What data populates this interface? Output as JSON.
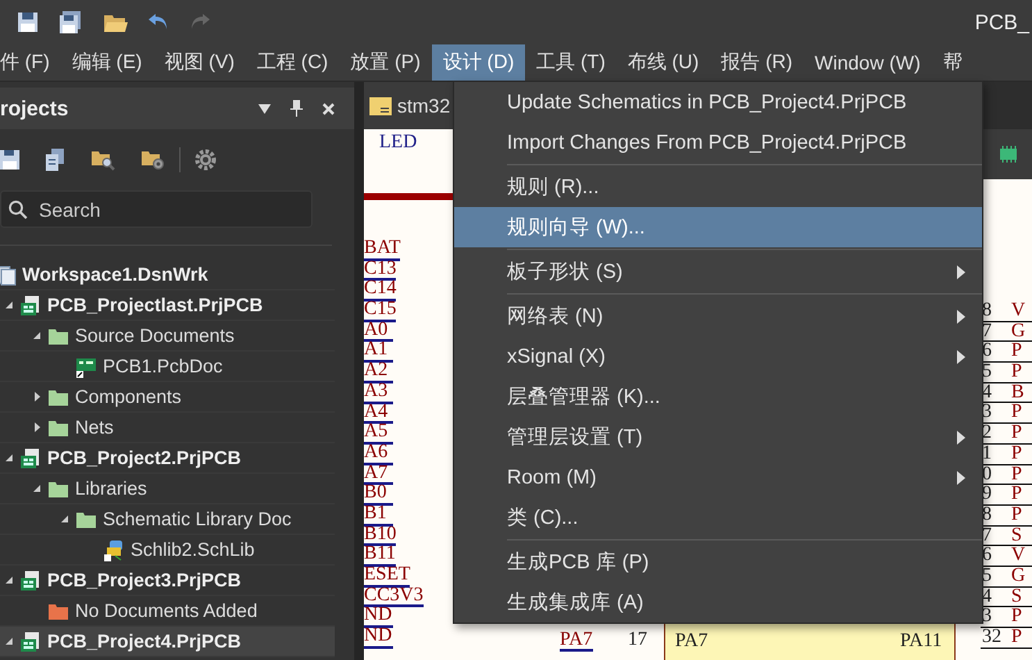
{
  "title_bar": {
    "title": "PCB_"
  },
  "menu_bar": [
    {
      "label": "件 (F)",
      "selected": false
    },
    {
      "label": "编辑 (E)",
      "selected": false
    },
    {
      "label": "视图 (V)",
      "selected": false
    },
    {
      "label": "工程 (C)",
      "selected": false
    },
    {
      "label": "放置 (P)",
      "selected": false
    },
    {
      "label": "设计 (D)",
      "selected": true
    },
    {
      "label": "工具 (T)",
      "selected": false
    },
    {
      "label": "布线 (U)",
      "selected": false
    },
    {
      "label": "报告 (R)",
      "selected": false
    },
    {
      "label": "Window (W)",
      "selected": false
    },
    {
      "label": "帮",
      "selected": false
    }
  ],
  "panel": {
    "title": "rojects",
    "search": {
      "placeholder": "Search"
    },
    "tree": [
      {
        "label": "Workspace1.DsnWrk",
        "kind": "workspace",
        "selected": false,
        "children": [
          {
            "label": "PCB_Projectlast.PrjPCB",
            "kind": "project",
            "expanded": true,
            "selected": false,
            "children": [
              {
                "label": "Source Documents",
                "kind": "folder",
                "expanded": true,
                "selected": false,
                "children": [
                  {
                    "label": "PCB1.PcbDoc",
                    "kind": "pcbdoc",
                    "selected": false
                  }
                ]
              },
              {
                "label": "Components",
                "kind": "folder",
                "expanded": false,
                "selected": false
              },
              {
                "label": "Nets",
                "kind": "folder",
                "expanded": false,
                "selected": false
              }
            ]
          },
          {
            "label": "PCB_Project2.PrjPCB",
            "kind": "project",
            "expanded": true,
            "selected": false,
            "children": [
              {
                "label": "Libraries",
                "kind": "folder",
                "expanded": true,
                "selected": false,
                "children": [
                  {
                    "label": "Schematic Library Doc",
                    "kind": "folder",
                    "expanded": true,
                    "selected": false,
                    "children": [
                      {
                        "label": "Schlib2.SchLib",
                        "kind": "schlib",
                        "selected": false
                      }
                    ]
                  }
                ]
              }
            ]
          },
          {
            "label": "PCB_Project3.PrjPCB",
            "kind": "project",
            "expanded": true,
            "selected": false,
            "children": [
              {
                "label": "No Documents Added",
                "kind": "empty-folder",
                "selected": false
              }
            ]
          },
          {
            "label": "PCB_Project4.PrjPCB",
            "kind": "project",
            "expanded": true,
            "selected": true
          }
        ]
      }
    ]
  },
  "document": {
    "tab": "stm32",
    "top_label": "LED",
    "left_nets": [
      "BAT",
      "C13",
      "C14",
      "C15",
      "A0",
      "A1",
      "A2",
      "A3",
      "A4",
      "A5",
      "A6",
      "A7",
      "B0",
      "B1",
      "B10",
      "B11",
      "ESET",
      "CC3V3",
      "ND",
      "ND"
    ],
    "right_pins": [
      {
        "number": "8",
        "net": "V"
      },
      {
        "number": "7",
        "net": "G"
      },
      {
        "number": "6",
        "net": "P"
      },
      {
        "number": "5",
        "net": "P"
      },
      {
        "number": "4",
        "net": "B"
      },
      {
        "number": "3",
        "net": "P"
      },
      {
        "number": "2",
        "net": "P"
      },
      {
        "number": "1",
        "net": "P"
      },
      {
        "number": "0",
        "net": "P"
      },
      {
        "number": "9",
        "net": "P"
      },
      {
        "number": "8",
        "net": "P"
      },
      {
        "number": "7",
        "net": "S"
      },
      {
        "number": "6",
        "net": "V"
      },
      {
        "number": "5",
        "net": "G"
      },
      {
        "number": "4",
        "net": "S"
      },
      {
        "number": "3",
        "net": "P"
      },
      {
        "number": "32",
        "net": "P"
      }
    ],
    "bottom_pin": {
      "net": "PA7",
      "number": "17",
      "pin_left": "PA7",
      "pin_right": "PA11"
    }
  },
  "dropdown": [
    {
      "kind": "item",
      "label": "Update Schematics in PCB_Project4.PrjPCB",
      "submenu": false,
      "selected": false
    },
    {
      "kind": "item",
      "label": "Import Changes From PCB_Project4.PrjPCB",
      "submenu": false,
      "selected": false
    },
    {
      "kind": "separator"
    },
    {
      "kind": "item",
      "label": "规则 (R)...",
      "submenu": false,
      "selected": false
    },
    {
      "kind": "item",
      "label": "规则向导 (W)...",
      "submenu": false,
      "selected": true
    },
    {
      "kind": "separator"
    },
    {
      "kind": "item",
      "label": "板子形状 (S)",
      "submenu": true,
      "selected": false
    },
    {
      "kind": "separator"
    },
    {
      "kind": "item",
      "label": "网络表 (N)",
      "submenu": true,
      "selected": false
    },
    {
      "kind": "item",
      "label": "xSignal (X)",
      "submenu": true,
      "selected": false
    },
    {
      "kind": "item",
      "label": "层叠管理器 (K)...",
      "submenu": false,
      "selected": false
    },
    {
      "kind": "item",
      "label": "管理层设置 (T)",
      "submenu": true,
      "selected": false
    },
    {
      "kind": "item",
      "label": "Room (M)",
      "submenu": true,
      "selected": false
    },
    {
      "kind": "item",
      "label": "类 (C)...",
      "submenu": false,
      "selected": false
    },
    {
      "kind": "separator"
    },
    {
      "kind": "item",
      "label": "生成PCB 库 (P)",
      "submenu": false,
      "selected": false
    },
    {
      "kind": "item",
      "label": "生成集成库 (A)",
      "submenu": false,
      "selected": false
    }
  ]
}
